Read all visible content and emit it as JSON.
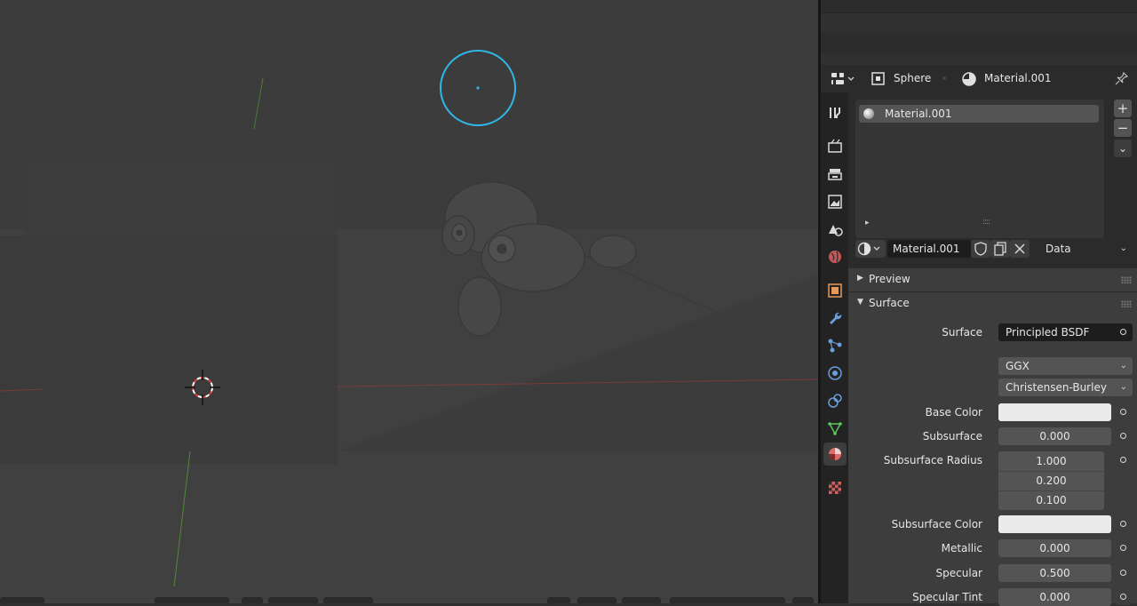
{
  "viewport": {
    "scene_objects": [
      "light-sphere",
      "suzanne-monkey",
      "box",
      "3d-cursor"
    ]
  },
  "properties_header": {
    "object_name": "Sphere",
    "material_name": "Material.001"
  },
  "material_slots": {
    "items": [
      "Material.001"
    ],
    "add_label": "+",
    "remove_label": "−",
    "more_label": "⌄",
    "expand_label": "▸",
    "grip_label": "::::"
  },
  "material_selector": {
    "name": "Material.001",
    "link": "Data"
  },
  "panels": {
    "preview": "Preview",
    "surface": "Surface"
  },
  "surface": {
    "surface_label": "Surface",
    "surface_value": "Principled BSDF",
    "distribution": "GGX",
    "subsurface_method": "Christensen-Burley",
    "rows": [
      {
        "label": "Base Color",
        "value": ""
      },
      {
        "label": "Subsurface",
        "value": "0.000"
      },
      {
        "label": "Subsurface Radius",
        "value": [
          "1.000",
          "0.200",
          "0.100"
        ]
      },
      {
        "label": "Subsurface Color",
        "value": ""
      },
      {
        "label": "Metallic",
        "value": "0.000"
      },
      {
        "label": "Specular",
        "value": "0.500"
      },
      {
        "label": "Specular Tint",
        "value": "0.000"
      }
    ]
  },
  "colors": {
    "accent_blue": "#2fb7e8",
    "active_tab": "#3d3d3d",
    "material_tab": "#e06a6a"
  }
}
